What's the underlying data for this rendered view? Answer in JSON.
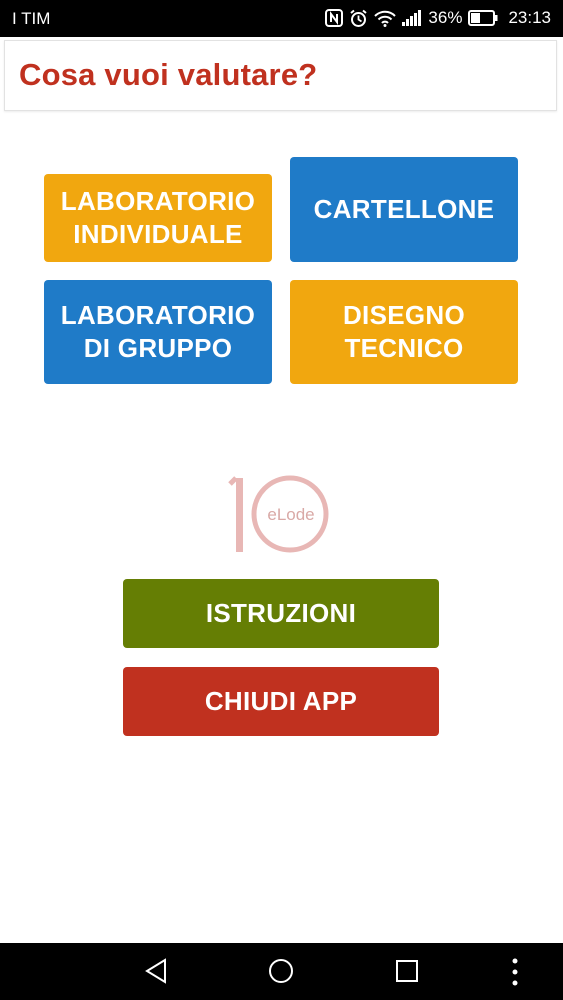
{
  "status_bar": {
    "carrier": "I TIM",
    "battery": "36%",
    "time": "23:13",
    "icons": [
      "nfc-icon",
      "alarm-icon",
      "wifi-icon",
      "signal-icon",
      "battery-icon"
    ]
  },
  "header": {
    "title": "Cosa vuoi valutare?"
  },
  "tiles": [
    {
      "label": "LABORATORIO\nINDIVIDUALE",
      "color": "#f1a70f"
    },
    {
      "label": "CARTELLONE",
      "color": "#1f7bc8"
    },
    {
      "label": "LABORATORIO\nDI GRUPPO",
      "color": "#1f7bc8"
    },
    {
      "label": "DISEGNO\nTECNICO",
      "color": "#f1a70f"
    }
  ],
  "logo": {
    "number": "10",
    "text": "eLode",
    "color": "#e8b7b5"
  },
  "actions": {
    "instructions": {
      "label": "ISTRUZIONI",
      "color": "#657e04"
    },
    "close": {
      "label": "CHIUDI APP",
      "color": "#c0311f"
    }
  },
  "nav_bar": {
    "icons": [
      "back-icon",
      "home-icon",
      "recents-icon",
      "more-icon"
    ]
  },
  "colors": {
    "title": "#c0311f",
    "status_bar": "#000000",
    "background": "#ffffff"
  }
}
